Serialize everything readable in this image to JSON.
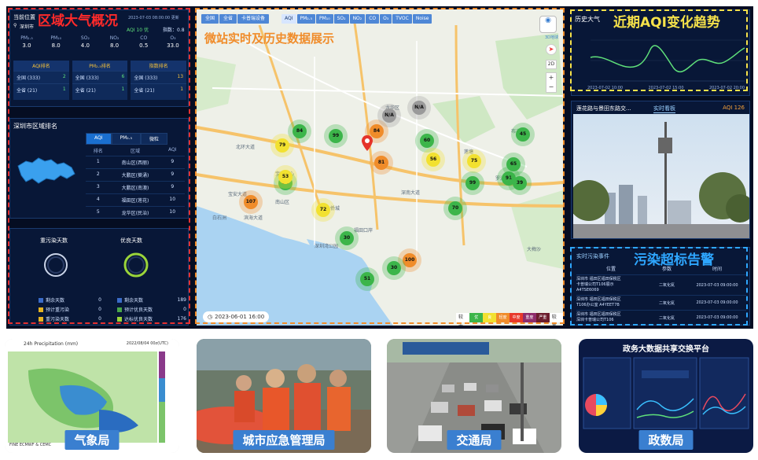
{
  "left": {
    "title_overlay": "区域大气概况",
    "location_label": "当前位置",
    "location_value": "深圳市",
    "datetime": "2023-07-03 08:00:00 更新",
    "aqi_label": "AQI 10 优",
    "index_label": "指数：0.8",
    "pollutants": [
      {
        "name": "PM₂.₅",
        "value": "3.0"
      },
      {
        "name": "PM₁₀",
        "value": "8.0"
      },
      {
        "name": "SO₂",
        "value": "4.0"
      },
      {
        "name": "NO₂",
        "value": "8.0"
      },
      {
        "name": "CO",
        "value": "0.5"
      },
      {
        "name": "O₃",
        "value": "33.0"
      }
    ],
    "rank_headers": [
      "AQI排名",
      "PM₂.₅排名",
      "指数排名"
    ],
    "rank_rows": [
      [
        "全国 (333)",
        "2",
        "全国 (333)",
        "6",
        "全国 (333)",
        "13"
      ],
      [
        "全省 (21)",
        "1",
        "全省 (21)",
        "1",
        "全省 (21)",
        "1"
      ]
    ],
    "district_title": "深圳市区域排名",
    "district_tabs": [
      "AQI",
      "PM₂.₅",
      "微粒"
    ],
    "district_headers": [
      "排名",
      "区域",
      "AQI"
    ],
    "district_rows": [
      [
        "1",
        "南山区(西丽)",
        "9"
      ],
      [
        "2",
        "大鹏区(葵涌)",
        "9"
      ],
      [
        "3",
        "大鹏区(南澳)",
        "9"
      ],
      [
        "4",
        "福田区(莲花)",
        "10"
      ],
      [
        "5",
        "龙华区(民治)",
        "10"
      ]
    ],
    "pollution_days_label": "重污染天数",
    "good_days_label": "优良天数",
    "legend_left": [
      {
        "label": "剩余天数",
        "value": "0",
        "color": "#3a6bc8"
      },
      {
        "label": "预计重污染",
        "value": "0",
        "color": "#e6b422"
      },
      {
        "label": "重污染天数",
        "value": "0",
        "color": "#e6b422"
      }
    ],
    "legend_right": [
      {
        "label": "剩余天数",
        "value": "189",
        "color": "#3a6bc8"
      },
      {
        "label": "预计优良天数",
        "value": "0",
        "color": "#4aa64a"
      },
      {
        "label": "达标优良天数",
        "value": "176",
        "color": "#9ad43a"
      }
    ]
  },
  "map": {
    "title_overlay": "微站实时及历史数据展示",
    "top_buttons": [
      "全国",
      "全省",
      "卡普瑞设备"
    ],
    "pollutant_tabs": [
      "AQI",
      "PM₂.₅",
      "PM₁₀",
      "SO₂",
      "NO₂",
      "CO",
      "O₃",
      "TVOC",
      "Noise"
    ],
    "timestamp": "2023-06-01 16:00",
    "compass_label": "3D地球",
    "legend_items": [
      "优",
      "良",
      "轻度",
      "中度",
      "重度",
      "严重"
    ],
    "legend_colors": [
      "#3cb54a",
      "#f2e130",
      "#f08c2a",
      "#e8392b",
      "#8e2c6b",
      "#6b1c2c"
    ],
    "legend_prefix": "较大",
    "legend_suffix": "较差",
    "place_labels": [
      "宝安大道",
      "北环大道",
      "深南大道",
      "滨海大道",
      "宝安中心",
      "深圳湾公园",
      "福田口岸",
      "罗湖区",
      "大梅沙",
      "南山区",
      "龙华区",
      "布吉",
      "莲塘",
      "侨城",
      "白石洲"
    ],
    "markers": [
      {
        "v": "84",
        "c": "#3cb54a"
      },
      {
        "v": "79",
        "c": "#f2e130"
      },
      {
        "v": "99",
        "c": "#3cb54a"
      },
      {
        "v": "94",
        "c": "#3cb54a"
      },
      {
        "v": "53",
        "c": "#f2e130"
      },
      {
        "v": "60",
        "c": "#3cb54a"
      },
      {
        "v": "56",
        "c": "#f2e130"
      },
      {
        "v": "75",
        "c": "#f2e130"
      },
      {
        "v": "107",
        "c": "#f08c2a"
      },
      {
        "v": "72",
        "c": "#f2e130"
      },
      {
        "v": "99",
        "c": "#3cb54a"
      },
      {
        "v": "30",
        "c": "#3cb54a"
      },
      {
        "v": "51",
        "c": "#3cb54a"
      },
      {
        "v": "100",
        "c": "#f08c2a"
      },
      {
        "v": "70",
        "c": "#3cb54a"
      },
      {
        "v": "91",
        "c": "#3cb54a"
      },
      {
        "v": "84",
        "c": "#f08c2a"
      },
      {
        "v": "81",
        "c": "#f08c2a"
      },
      {
        "v": "N/A",
        "c": "#9a9a9a"
      },
      {
        "v": "N/A",
        "c": "#9a9a9a"
      },
      {
        "v": "45",
        "c": "#3cb54a"
      },
      {
        "v": "30",
        "c": "#3cb54a"
      },
      {
        "v": "65",
        "c": "#3cb54a"
      },
      {
        "v": "39",
        "c": "#3cb54a"
      }
    ]
  },
  "right": {
    "title_overlay": "近期AQI变化趋势",
    "history_label": "历史大气",
    "chart_times": [
      "2023-07-02 10:00",
      "2023-07-02 15:00",
      "2023-07-02 20:00"
    ],
    "station_title": "莲花路与景田东路交...",
    "live_label": "实时看板",
    "aqi_value": "AQI 126",
    "event_overlay": "污染超标告警",
    "event_title": "实时污染事件",
    "event_headers": [
      "位置",
      "参数",
      "时间"
    ],
    "events": [
      {
        "loc1": "深圳市 福田区福田保税区",
        "loc2": "卡普瑞公司T106展示",
        "loc3": "A4TSE6069",
        "param": "二氧化氮",
        "time": "2023-07-03 09:00:00"
      },
      {
        "loc1": "深圳市 福田区福田保税区",
        "loc2": "T106办公室 A4YEET7B",
        "loc3": "",
        "param": "二氧化氮",
        "time": "2023-07-03 09:00:00"
      },
      {
        "loc1": "深圳市 福田区福田保税区",
        "loc2": "深圳卡普瑞公司T106",
        "loc3": "",
        "param": "二氧化氮",
        "time": "2023-07-03 09:00:00"
      }
    ]
  },
  "bottom": {
    "cards": [
      {
        "label": "气象局",
        "title": "24h Precipitation (mm)",
        "sub": "2022/08/04 00z(UTC)",
        "footer": "FINE ECMWF & CEMC"
      },
      {
        "label": "城市应急管理局"
      },
      {
        "label": "交通局"
      },
      {
        "label": "政数局",
        "title": "政务大数据共享交换平台"
      }
    ]
  }
}
